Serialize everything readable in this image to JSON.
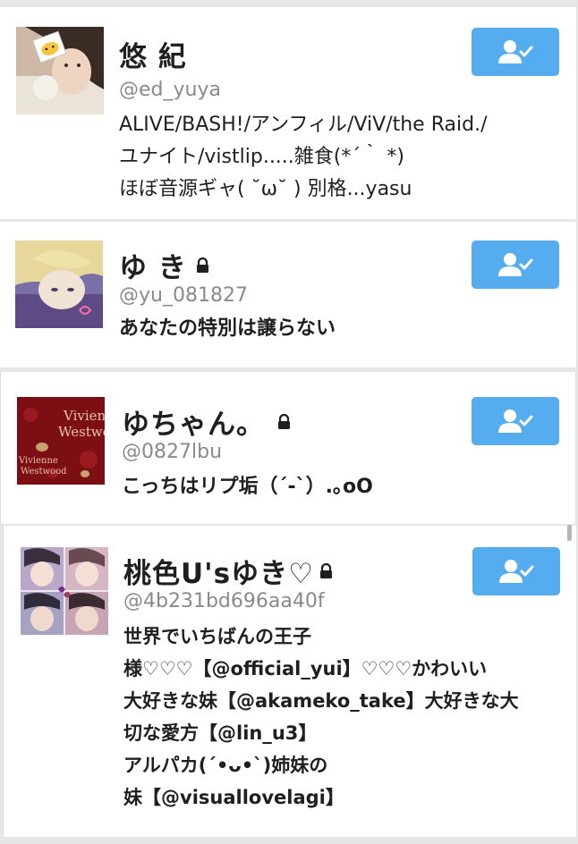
{
  "users": [
    {
      "name": "悠 紀",
      "handle": "@ed_yuya",
      "protected": false,
      "bio": [
        "ALIVE/BASH!/アンフィル/ViV/the Raid./",
        "ユナイト/vistlip.....雑食(*´｀ *)",
        "ほぼ音源ギャ( ˘ω˘ ) 別格...yasu"
      ]
    },
    {
      "name": "ゆ き",
      "handle": "@yu_081827",
      "protected": true,
      "bio": [
        "あなたの特別は譲らない"
      ]
    },
    {
      "name": "ゆちゃん。",
      "handle": "@0827lbu",
      "protected": true,
      "bio": [
        "こっちはリプ垢（´-`）.｡oO"
      ]
    },
    {
      "name": "桃色U'sゆき♡",
      "handle": "@4b231bd696aa40f",
      "protected": true,
      "bio": [
        "世界でいちばんの王子",
        "様♡♡♡【@official_yui】♡♡♡かわいい",
        "大好きな妹【@akameko_take】大好きな大",
        "切な愛方【@lin_u3】",
        "アルパカ(´•ᴗ•`)姉妹の",
        "妹【@visuallovelagi】"
      ]
    }
  ],
  "avatar_text": {
    "vw_line1": "Vivienne",
    "vw_line2": "Westwood"
  },
  "colors": {
    "follow_button": "#55acee",
    "name_text": "#1f1f1f",
    "handle_text": "#8a8a8a",
    "divider": "#e6e6e6"
  },
  "icons": {
    "follow": "person-check-icon",
    "protected": "lock-icon"
  }
}
